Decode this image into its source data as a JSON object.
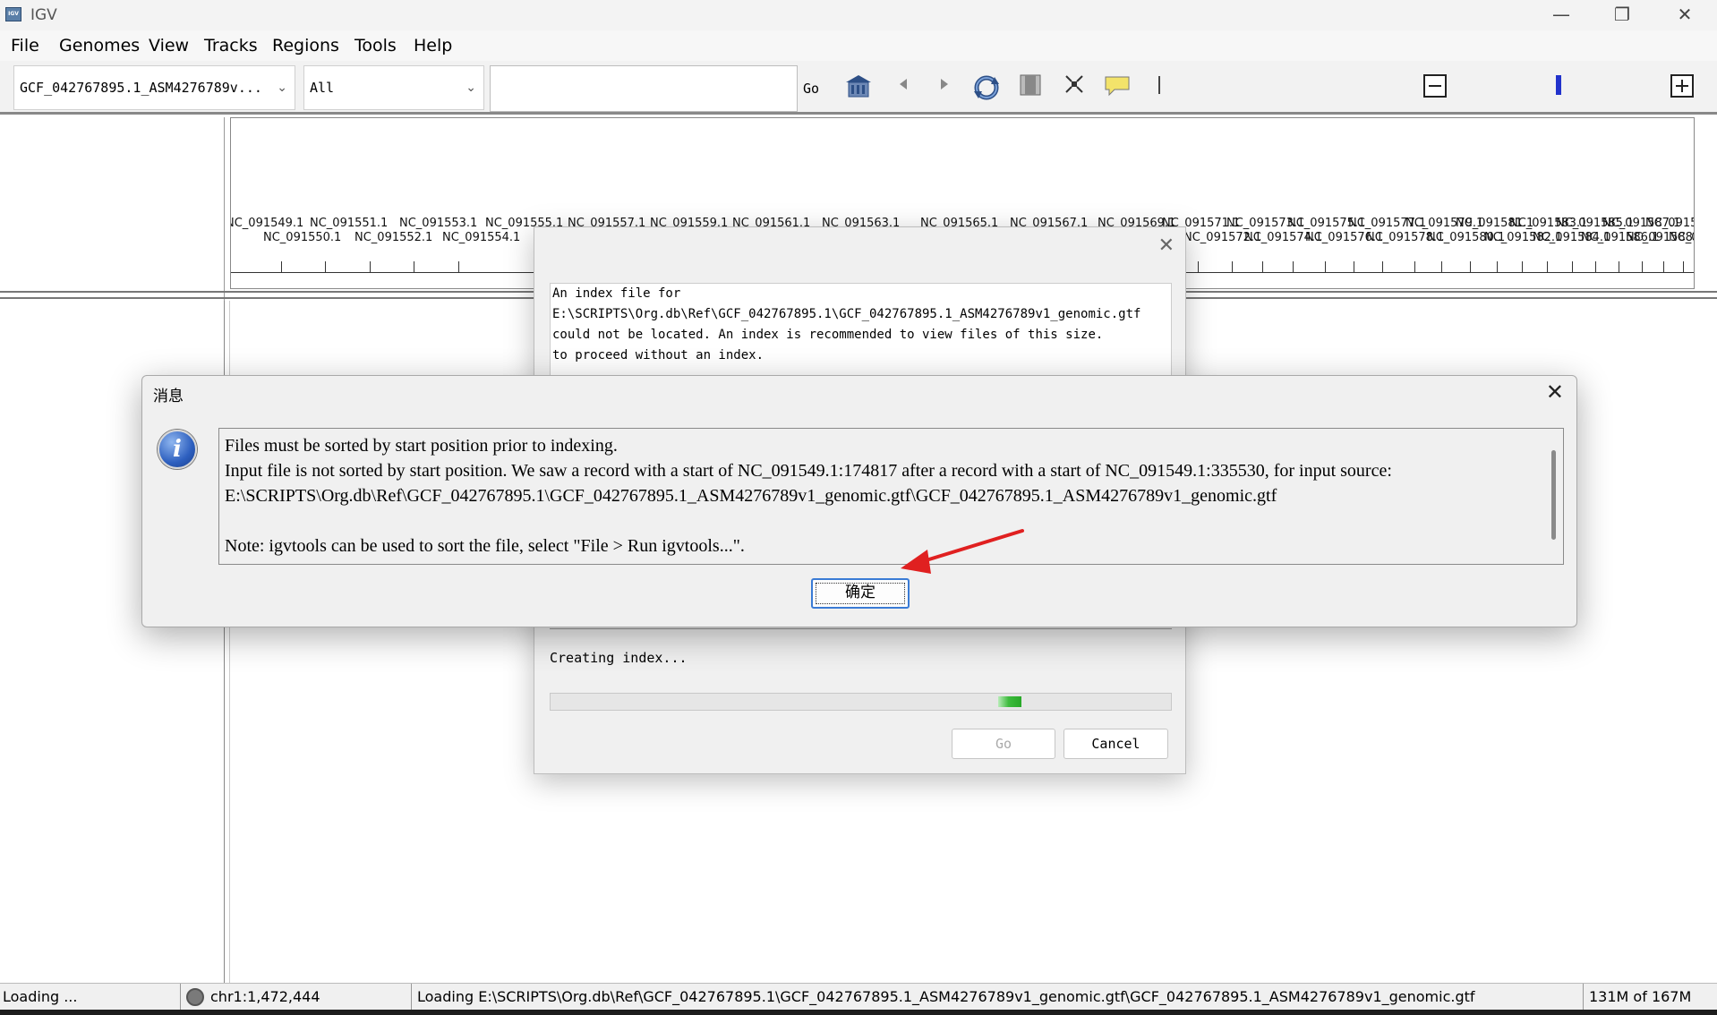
{
  "window": {
    "title": "IGV",
    "logo_text": "IGV"
  },
  "menu": {
    "items": [
      "File",
      "Genomes",
      "View",
      "Tracks",
      "Regions",
      "Tools",
      "Help"
    ]
  },
  "toolbar": {
    "genome_value": "GCF_042767895.1_ASM4276789v...",
    "chromosome_value": "All",
    "locus_value": "",
    "go_label": "Go",
    "icons": [
      "home-icon",
      "back-icon",
      "forward-icon",
      "refresh-icon",
      "roi-icon",
      "resize-icon",
      "popup-text-icon",
      "ruler-line-icon",
      "zoom-out-icon",
      "zoom-slider-icon",
      "zoom-in-icon"
    ]
  },
  "ruler": {
    "labels_top": [
      "NC_091549.1",
      "NC_091551.1",
      "NC_091553.1",
      "NC_091555.1",
      "NC_091557.1",
      "NC_091559.1",
      "NC_091561.1",
      "NC_091563.1",
      "NC_091565.1",
      "NC_091567.1",
      "NC_091569.1",
      "NC_091571.1",
      "NC_091573.1",
      "NC_091575.1",
      "NC_091577.1",
      "NC_091579.1",
      "NC_091581.1",
      "NC_091583.1",
      "NC_091585.1",
      "NC_091587.1",
      "NC_091589.1"
    ],
    "labels_bottom": [
      "NC_091550.1",
      "NC_091552.1",
      "NC_091554.1",
      "NC_091572.1",
      "NC_091574.1",
      "NC_091576.1",
      "NC_091578.1",
      "NC_091580.1",
      "NC_091582.1",
      "NC_091584.1",
      "NC_091586.1",
      "NC_091588.1",
      "NC_091590.1"
    ]
  },
  "index_dialog": {
    "lines": [
      "An index file for",
      "E:\\SCRIPTS\\Org.db\\Ref\\GCF_042767895.1\\GCF_042767895.1_ASM4276789v1_genomic.gtf",
      " could not be located. An index is recommended to view files of this size.",
      "to proceed without an index."
    ],
    "status": "Creating index...",
    "progress": 0.05,
    "go_label": "Go",
    "cancel_label": "Cancel"
  },
  "message_dialog": {
    "title": "消息",
    "lines": [
      "Files must be sorted by start position prior to indexing.",
      "Input file is not sorted by start position. We saw a record with a start of NC_091549.1:174817 after a record with a start of NC_091549.1:335530, for input source:",
      "E:\\SCRIPTS\\Org.db\\Ref\\GCF_042767895.1\\GCF_042767895.1_ASM4276789v1_genomic.gtf\\GCF_042767895.1_ASM4276789v1_genomic.gtf",
      "",
      "Note: igvtools can be used to sort the file, select \"File > Run igvtools...\"."
    ],
    "ok_label": "确定"
  },
  "status_bar": {
    "message": "Loading ...",
    "position": "chr1:1,472,444",
    "detail": "Loading E:\\SCRIPTS\\Org.db\\Ref\\GCF_042767895.1\\GCF_042767895.1_ASM4276789v1_genomic.gtf\\GCF_042767895.1_ASM4276789v1_genomic.gtf",
    "memory": "131M of 167M"
  },
  "colors": {
    "arrow": "#e02020",
    "focus": "#3a7bd5",
    "progress": "#28a828"
  }
}
